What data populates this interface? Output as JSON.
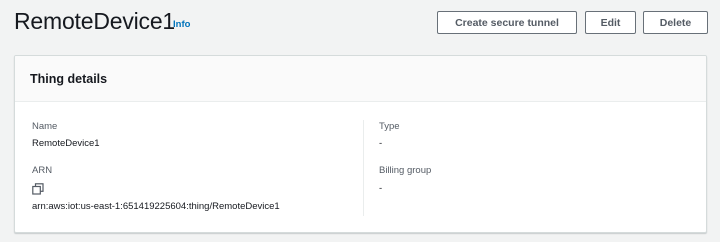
{
  "header": {
    "title": "RemoteDevice1",
    "info_label": "Info",
    "buttons": {
      "create_tunnel": "Create secure tunnel",
      "edit": "Edit",
      "delete": "Delete"
    }
  },
  "details": {
    "title": "Thing details",
    "name_label": "Name",
    "name_value": "RemoteDevice1",
    "arn_label": "ARN",
    "arn_copy_icon": "copy-icon",
    "arn_value": "arn:aws:iot:us-east-1:651419225604:thing/RemoteDevice1",
    "type_label": "Type",
    "type_value": "-",
    "billing_group_label": "Billing group",
    "billing_group_value": "-"
  },
  "colors": {
    "background": "#f2f3f3",
    "link": "#0073bb",
    "text": "#16191f",
    "muted_text": "#545b64",
    "button_border": "#687078"
  }
}
